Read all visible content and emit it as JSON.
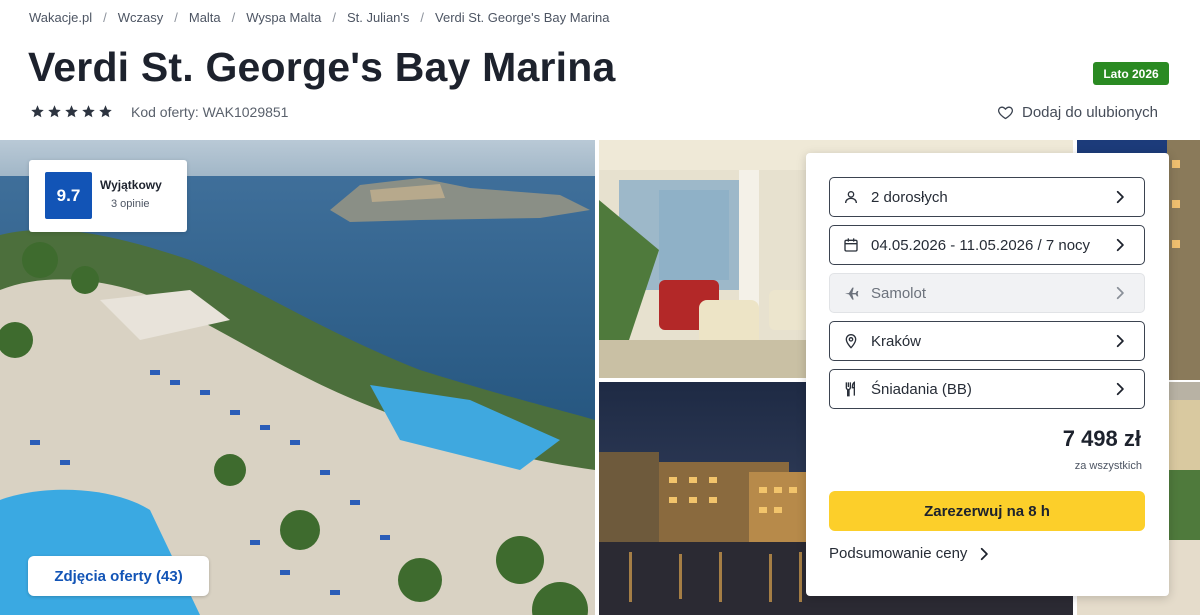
{
  "breadcrumb": [
    "Wakacje.pl",
    "Wczasy",
    "Malta",
    "Wyspa Malta",
    "St. Julian's",
    "Verdi St. George's Bay Marina"
  ],
  "hotel": {
    "name": "Verdi St. George's Bay Marina",
    "stars": 5,
    "offer_code": "Kod oferty: WAK1029851",
    "season_badge": "Lato 2026",
    "favorite_label": "Dodaj do ulubionych"
  },
  "rating": {
    "score": "9.7",
    "label": "Wyjątkowy",
    "reviews": "3 opinie"
  },
  "gallery": {
    "photos_button": "Zdjęcia oferty (43)"
  },
  "booking": {
    "fields": [
      {
        "icon": "person-icon",
        "value": "2 dorosłych",
        "disabled": false
      },
      {
        "icon": "calendar-icon",
        "value": "04.05.2026 - 11.05.2026 / 7 nocy",
        "disabled": false
      },
      {
        "icon": "plane-icon",
        "value": "Samolot",
        "disabled": true
      },
      {
        "icon": "location-pin-icon",
        "value": "Kraków",
        "disabled": false
      },
      {
        "icon": "cutlery-icon",
        "value": "Śniadania (BB)",
        "disabled": false
      }
    ],
    "price": "7 498 zł",
    "price_note": "za wszystkich",
    "book_button": "Zarezerwuj na 8 h",
    "summary_link": "Podsumowanie ceny"
  },
  "colors": {
    "brand_blue": "#1254b6",
    "cta_yellow": "#fccf2a",
    "badge_green": "#2a8a22"
  }
}
